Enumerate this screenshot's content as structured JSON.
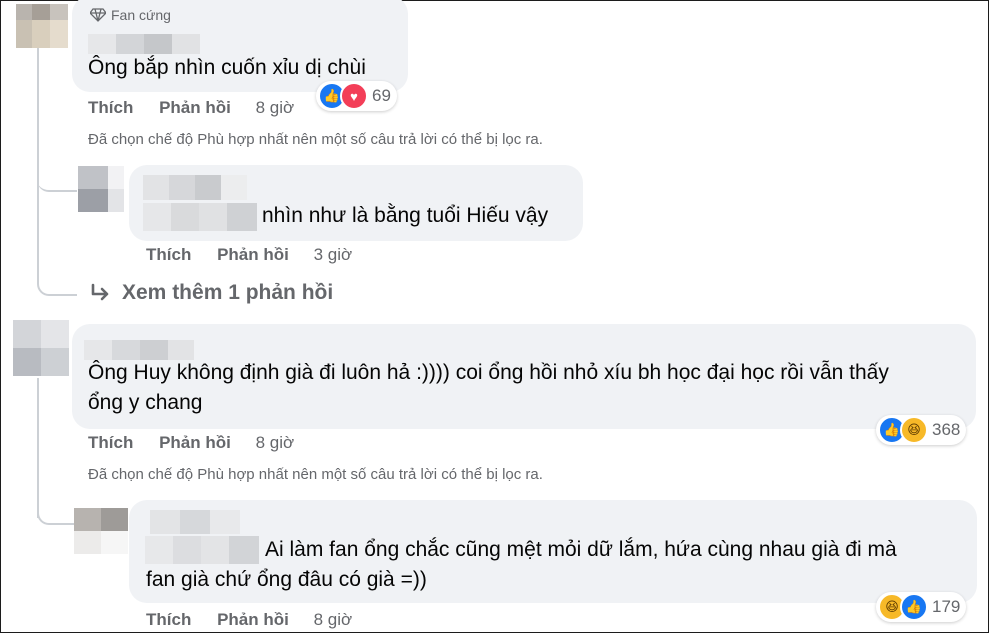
{
  "comments": [
    {
      "badge": "Fan cứng",
      "text": "Ông bắp nhìn cuốn xỉu dị chùi",
      "like_label": "Thích",
      "reply_label": "Phản hồi",
      "time": "8 giờ",
      "reaction_count": "69",
      "reactions": [
        "like-icon",
        "love-icon"
      ],
      "filter_note": "Đã chọn chế độ Phù hợp nhất nên một số câu trả lời có thể bị lọc ra."
    },
    {
      "text": "nhìn như là bằng tuổi Hiếu vậy",
      "like_label": "Thích",
      "reply_label": "Phản hồi",
      "time": "3 giờ"
    },
    {
      "view_more": "Xem thêm 1 phản hồi"
    },
    {
      "text_line1": "Ông Huy không định già đi luôn hả :)))) coi ổng hồi nhỏ xíu bh học đại học rồi vẫn thấy",
      "text_line2": "ổng y chang",
      "like_label": "Thích",
      "reply_label": "Phản hồi",
      "time": "8 giờ",
      "reaction_count": "368",
      "reactions": [
        "like-icon",
        "haha-icon"
      ],
      "filter_note": "Đã chọn chế độ Phù hợp nhất nên một số câu trả lời có thể bị lọc ra."
    },
    {
      "text_line1": "Ai làm fan ổng chắc cũng mệt mỏi dữ lắm, hứa cùng nhau già đi mà",
      "text_line2": "fan già chứ ổng đâu có già =))",
      "like_label": "Thích",
      "reply_label": "Phản hồi",
      "time": "8 giờ",
      "reaction_count": "179",
      "reactions": [
        "haha-icon",
        "like-icon"
      ]
    }
  ],
  "colors": {
    "bubble": "#f0f2f5",
    "secondary_text": "#65676b",
    "like_blue": "#1877f2",
    "love_red": "#f33e58",
    "haha_yellow": "#f7b928"
  }
}
